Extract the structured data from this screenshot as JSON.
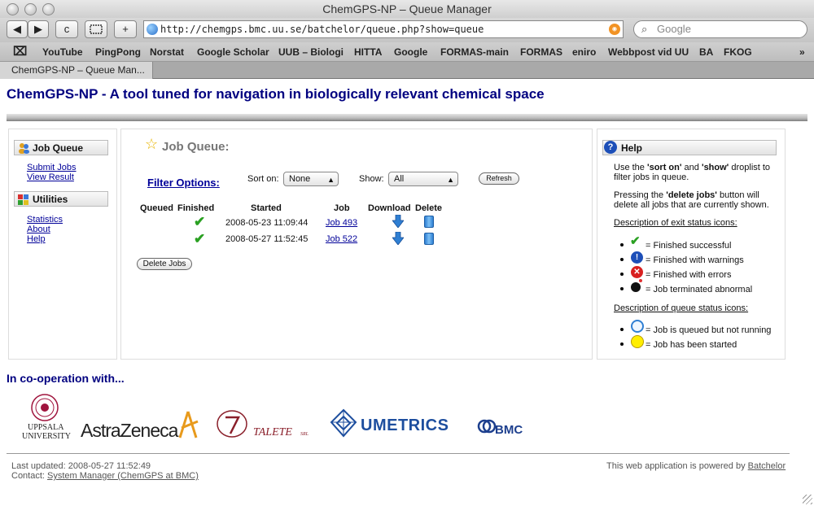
{
  "window": {
    "title": "ChemGPS-NP – Queue Manager"
  },
  "toolbar": {
    "back": "◀",
    "forward": "▶",
    "reload": "c",
    "add": "+",
    "url": "http://chemgps.bmc.uu.se/batchelor/queue.php?show=queue",
    "search_placeholder": "Google"
  },
  "bookmarks": [
    "YouTube",
    "PingPong",
    "Norstat",
    "Google Scholar",
    "UUB – Biologi",
    "HITTA",
    "Google",
    "FORMAS-main",
    "FORMAS",
    "eniro",
    "Webbpost vid UU",
    "BA",
    "FKOG"
  ],
  "tab": {
    "label": "ChemGPS-NP – Queue Man..."
  },
  "banner": "ChemGPS-NP - A tool tuned for navigation in biologically relevant chemical space",
  "sidebar": {
    "job_queue_title": "Job Queue",
    "job_links": [
      "Submit Jobs",
      "View Result"
    ],
    "utilities_title": "Utilities",
    "utility_links": [
      "Statistics",
      "About",
      "Help"
    ]
  },
  "main": {
    "title": "Job Queue:",
    "filter_label": "Filter Options:",
    "sort_label": "Sort on:",
    "sort_value": "None",
    "show_label": "Show:",
    "show_value": "All",
    "refresh_label": "Refresh",
    "columns": [
      "Queued",
      "Finished",
      "Started",
      "Job",
      "Download",
      "Delete"
    ],
    "rows": [
      {
        "started": "2008-05-23 11:09:44",
        "job": "Job 493"
      },
      {
        "started": "2008-05-27 11:52:45",
        "job": "Job 522"
      }
    ],
    "delete_label": "Delete Jobs"
  },
  "help": {
    "title": "Help",
    "p1_a": "Use the ",
    "p1_b": "'sort on'",
    "p1_c": " and ",
    "p1_d": "'show'",
    "p1_e": " droplist to",
    "p1_f": "filter jobs in queue.",
    "p2_a": "Pressing the ",
    "p2_b": "'delete jobs'",
    "p2_c": " button will",
    "p2_d": "delete all jobs that are currently shown.",
    "exit_heading": "Description of exit status icons:",
    "exit_items": [
      "= Finished successful",
      "= Finished with warnings",
      "= Finished with errors",
      "= Job terminated abnormal"
    ],
    "queue_heading": "Description of queue status icons:",
    "queue_items": [
      "= Job is queued but not running",
      "= Job has been started"
    ]
  },
  "cooperation": {
    "heading": "In co-operation with...",
    "logos": {
      "uppsala_1": "UPPSALA",
      "uppsala_2": "UNIVERSITY",
      "astrazeneca": "AstraZeneca",
      "talete": "TALETE",
      "talete_suffix": "SRL",
      "umetrics": "UMETRICS",
      "bmc": "BMC"
    }
  },
  "footer": {
    "last_updated": "Last updated: 2008-05-27 11:52:49",
    "contact_label": "Contact: ",
    "contact_link": "System Manager (ChemGPS at BMC)",
    "powered_text": "This web application is powered by ",
    "powered_link": "Batchelor"
  }
}
